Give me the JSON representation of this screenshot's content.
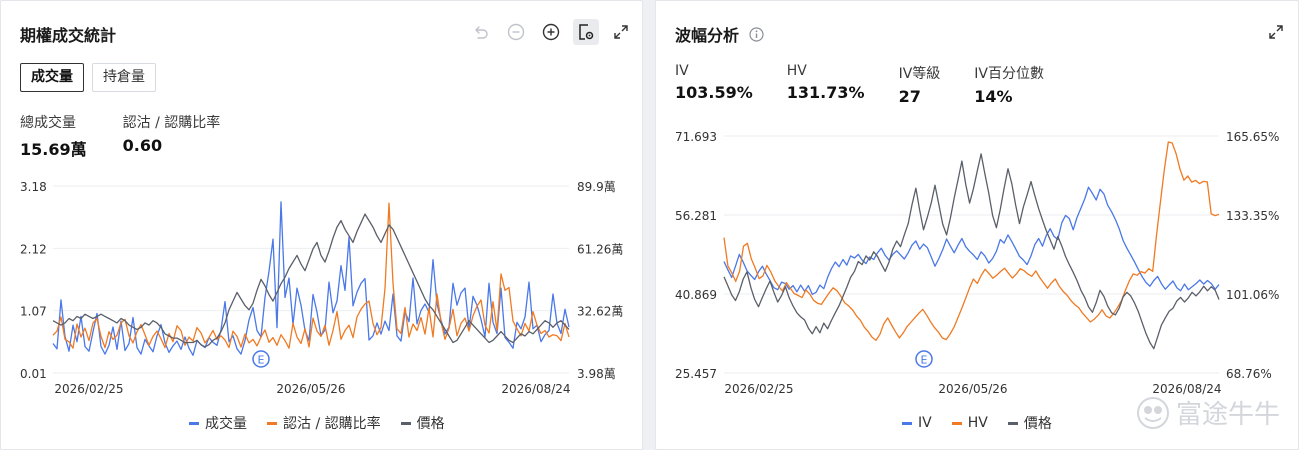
{
  "left": {
    "title": "期權成交統計",
    "tabs": [
      {
        "label": "成交量",
        "active": true
      },
      {
        "label": "持倉量",
        "active": false
      }
    ],
    "stats": [
      {
        "label": "總成交量",
        "value": "15.69萬"
      },
      {
        "label": "認沽 / 認購比率",
        "value": "0.60"
      }
    ],
    "y_left_ticks": [
      "3.18",
      "2.12",
      "1.07",
      "0.01"
    ],
    "y_right_ticks": [
      "89.9萬",
      "61.26萬",
      "32.62萬",
      "3.98萬"
    ],
    "x_ticks": [
      "2026/02/25",
      "2026/05/26",
      "2026/08/24"
    ],
    "event_marker": "E",
    "legend": [
      "成交量",
      "認沽 / 認購比率",
      "價格"
    ]
  },
  "right": {
    "title": "波幅分析",
    "stats": [
      {
        "label": "IV",
        "value": "103.59%"
      },
      {
        "label": "HV",
        "value": "131.73%"
      },
      {
        "label": "IV等級",
        "value": "27"
      },
      {
        "label": "IV百分位數",
        "value": "14%"
      }
    ],
    "y_left_ticks": [
      "71.693",
      "56.281",
      "40.869",
      "25.457"
    ],
    "y_right_ticks": [
      "165.65%",
      "133.35%",
      "101.06%",
      "68.76%"
    ],
    "x_ticks": [
      "2026/02/25",
      "2026/05/26",
      "2026/08/24"
    ],
    "event_marker": "E",
    "legend": [
      "IV",
      "HV",
      "價格"
    ],
    "watermark": "富途牛牛"
  },
  "colors": {
    "blue": "#4a78e8",
    "orange": "#f07a22",
    "gray": "#5a5f69",
    "grid": "#eceef1",
    "axis_text": "#333333"
  },
  "icons": [
    "undo-icon",
    "zoom-out-icon",
    "zoom-in-icon",
    "chart-settings-icon",
    "expand-icon",
    "info-icon"
  ],
  "chart_data": [
    {
      "type": "line",
      "title": "",
      "x_ticks": [
        "2026/02/25",
        "2026/05/26",
        "2026/08/24"
      ],
      "x_count": 130,
      "series": [
        {
          "name": "成交量",
          "axis": "left",
          "color": "#4a78e8",
          "ylim": [
            0.01,
            3.18
          ],
          "values": [
            0.51,
            0.42,
            1.25,
            0.63,
            0.38,
            0.82,
            0.54,
            0.97,
            0.46,
            0.38,
            0.71,
            1.02,
            0.46,
            0.33,
            0.48,
            0.79,
            0.41,
            0.89,
            0.39,
            0.51,
            0.95,
            0.44,
            0.33,
            0.58,
            0.47,
            0.37,
            0.64,
            0.83,
            0.52,
            0.36,
            0.47,
            0.55,
            0.41,
            0.62,
            0.43,
            0.31,
            0.56,
            0.49,
            0.44,
            0.61,
            0.53,
            0.48,
            0.74,
            1.22,
            0.54,
            0.64,
            0.42,
            0.33,
            0.56,
            0.91,
            1.12,
            0.73,
            0.62,
            1.29,
            1.73,
            2.28,
            0.78,
            2.91,
            1.29,
            1.62,
            0.83,
            1.45,
            1.16,
            0.73,
            0.56,
            1.34,
            1.04,
            0.64,
            0.74,
            1.55,
            1.03,
            1.23,
            1.83,
            1.41,
            2.31,
            1.15,
            1.38,
            1.53,
            1.61,
            0.57,
            0.64,
            0.86,
            0.67,
            0.89,
            0.73,
            1.35,
            0.64,
            0.55,
            1.05,
            0.88,
            1.62,
            0.84,
            1.07,
            1.18,
            1.04,
            1.93,
            1.18,
            0.91,
            0.67,
            0.79,
            1.53,
            1.16,
            1.37,
            1.45,
            0.75,
            1.31,
            1.16,
            0.92,
            0.62,
            1.53,
            0.87,
            0.68,
            1.45,
            0.61,
            0.53,
            0.43,
            0.87,
            0.76,
            0.96,
            1.55,
            0.76,
            0.82,
            0.54,
            0.66,
            0.73,
            1.35,
            0.85,
            0.68,
            1.09,
            0.79
          ]
        },
        {
          "name": "認沽 / 認購比率",
          "axis": "left",
          "color": "#f07a22",
          "ylim": [
            0.01,
            3.18
          ],
          "values": [
            0.65,
            0.72,
            0.96,
            0.58,
            0.54,
            0.43,
            0.84,
            0.62,
            0.77,
            0.56,
            0.86,
            0.93,
            0.63,
            0.44,
            0.71,
            0.58,
            0.65,
            0.86,
            0.92,
            0.64,
            0.52,
            0.71,
            0.83,
            0.66,
            0.48,
            0.63,
            0.72,
            0.59,
            0.44,
            0.68,
            0.54,
            0.81,
            0.73,
            0.48,
            0.62,
            0.55,
            0.78,
            0.69,
            0.52,
            0.61,
            0.73,
            0.58,
            0.64,
            0.57,
            0.44,
            0.72,
            0.63,
            0.45,
            0.67,
            0.52,
            0.58,
            0.47,
            0.62,
            0.74,
            0.53,
            0.61,
            0.48,
            0.66,
            0.56,
            0.43,
            0.85,
            0.62,
            0.51,
            0.76,
            0.45,
            0.94,
            0.72,
            0.63,
            0.82,
            0.48,
            0.73,
            1.05,
            0.58,
            0.73,
            0.82,
            0.61,
            0.96,
            1.09,
            1.18,
            1.23,
            0.85,
            0.66,
            0.78,
            1.44,
            2.89,
            1.53,
            0.76,
            0.68,
            1.12,
            0.62,
            0.84,
            0.73,
            0.95,
            0.67,
            1.11,
            0.62,
            1.35,
            0.88,
            0.58,
            0.77,
            1.09,
            0.64,
            0.85,
            0.94,
            0.72,
            0.98,
            1.14,
            1.25,
            0.82,
            0.69,
            1.22,
            0.73,
            1.69,
            1.41,
            1.46,
            0.89,
            0.76,
            0.64,
            0.85,
            0.72,
            1.05,
            0.82,
            0.68,
            0.73,
            0.62,
            0.66,
            0.64,
            0.56,
            0.85,
            0.62
          ]
        },
        {
          "name": "價格",
          "axis": "right",
          "color": "#5a5f69",
          "ylim": [
            3.98,
            89.9
          ],
          "values": [
            28,
            27,
            26,
            27,
            29,
            28,
            30,
            29,
            31,
            30,
            29,
            30,
            31,
            30,
            29,
            28,
            27,
            29,
            28,
            26,
            25,
            24,
            25,
            27,
            26,
            28,
            27,
            25,
            22,
            21,
            20,
            20,
            19,
            18,
            18,
            18,
            19,
            17,
            16,
            17,
            19,
            20,
            23,
            27,
            33,
            37,
            41,
            38,
            35,
            33,
            36,
            42,
            47,
            44,
            40,
            37,
            41,
            45,
            48,
            52,
            55,
            58,
            54,
            51,
            56,
            61,
            64,
            58,
            55,
            60,
            66,
            71,
            74,
            70,
            67,
            64,
            69,
            73,
            77,
            74,
            71,
            67,
            64,
            68,
            72,
            70,
            66,
            62,
            58,
            54,
            50,
            46,
            42,
            38,
            35,
            33,
            30,
            27,
            24,
            21,
            18,
            19,
            22,
            25,
            28,
            26,
            24,
            22,
            20,
            18,
            19,
            21,
            23,
            21,
            19,
            18,
            20,
            22,
            21,
            23,
            22,
            24,
            26,
            28,
            27,
            25,
            27,
            28,
            26,
            24
          ]
        }
      ]
    },
    {
      "type": "line",
      "title": "",
      "x_ticks": [
        "2026/02/25",
        "2026/05/26",
        "2026/08/24"
      ],
      "x_count": 130,
      "series": [
        {
          "name": "IV",
          "axis": "left",
          "color": "#4a78e8",
          "ylim": [
            25.457,
            71.693
          ],
          "values": [
            47.2,
            45.6,
            44.1,
            46.3,
            48.6,
            47.1,
            45.4,
            44.5,
            43.7,
            45.2,
            46.3,
            44.8,
            43.5,
            42.1,
            41.7,
            43.2,
            42.9,
            41.8,
            42.5,
            41.3,
            42.6,
            41.4,
            42.5,
            40.8,
            41.2,
            42.6,
            41.9,
            44.1,
            45.8,
            47.1,
            46.2,
            47.6,
            46.5,
            48.3,
            47.9,
            48.6,
            47.5,
            46.8,
            48.1,
            47.6,
            48.9,
            49.8,
            48.4,
            47.5,
            48.6,
            49.3,
            48.5,
            47.7,
            48.9,
            50.4,
            51.2,
            49.6,
            50.6,
            49.9,
            48.1,
            46.3,
            47.8,
            49.5,
            51.6,
            50.2,
            48.9,
            50.4,
            51.7,
            50.1,
            49.2,
            48.5,
            47.6,
            49.1,
            48.3,
            46.9,
            47.8,
            49.2,
            51.5,
            50.8,
            52.4,
            51.1,
            49.7,
            48.2,
            47.5,
            46.6,
            48.3,
            50.5,
            51.7,
            50.2,
            52.3,
            53.6,
            52.1,
            51.5,
            54.7,
            56.2,
            55.6,
            53.4,
            55.8,
            57.6,
            59.4,
            61.7,
            60.5,
            59.2,
            61.3,
            60.4,
            58.2,
            56.9,
            55.4,
            53.6,
            51.3,
            49.8,
            48.5,
            47.1,
            45.6,
            44.2,
            43.1,
            42.4,
            43.5,
            44.3,
            42.9,
            41.8,
            42.6,
            43.4,
            42.1,
            41.5,
            42.8,
            41.7,
            42.3,
            42.9,
            43.6,
            42.8,
            43.5,
            42.9,
            41.8,
            42.7
          ]
        },
        {
          "name": "HV",
          "axis": "right",
          "color": "#f07a22",
          "ylim": [
            68.76,
            165.65
          ],
          "values": [
            124.1,
            112.5,
            109.7,
            106.2,
            110.4,
            120.6,
            121.8,
            115.4,
            111.7,
            107.3,
            108.5,
            112.8,
            110.1,
            106.5,
            104.2,
            102.3,
            105.7,
            103.4,
            101.2,
            100.5,
            99.6,
            102.7,
            101.1,
            98.5,
            97.3,
            96.8,
            99.2,
            101.5,
            103.6,
            102.4,
            100.1,
            97.4,
            96.2,
            94.5,
            92.1,
            90.3,
            87.5,
            85.7,
            83.4,
            82.1,
            84.6,
            88.9,
            91.3,
            88.4,
            85.6,
            83.1,
            85.2,
            87.8,
            89.6,
            91.4,
            93.2,
            94.8,
            92.4,
            89.7,
            87.3,
            85.5,
            83.1,
            82.4,
            84.7,
            87.5,
            91.3,
            95.2,
            99.4,
            103.6,
            107.2,
            105.4,
            108.6,
            111.2,
            109.4,
            107.5,
            108.8,
            110.3,
            111.6,
            109.5,
            107.6,
            109.2,
            111.4,
            110.6,
            109.2,
            108.3,
            110.5,
            107.8,
            105.6,
            103.4,
            105.6,
            107.2,
            104.3,
            102.1,
            100.6,
            98.4,
            96.7,
            95.5,
            93.2,
            91.4,
            89.6,
            90.8,
            92.4,
            94.6,
            92.1,
            91.3,
            93.2,
            95.6,
            98.4,
            102.7,
            106.5,
            109.3,
            108.7,
            110.2,
            109.6,
            111.4,
            110.3,
            125.4,
            138.9,
            152.1,
            163.2,
            162.8,
            158.4,
            152.1,
            147.6,
            149.3,
            146.8,
            147.5,
            146.2,
            147.1,
            146.9,
            133.8,
            133.1,
            133.6
          ]
        },
        {
          "name": "價格",
          "axis": "left",
          "color": "#5a5f69",
          "ylim": [
            25.457,
            71.693
          ],
          "values": [
            44.2,
            42.5,
            40.7,
            39.6,
            41.3,
            43.8,
            45.2,
            42.1,
            39.8,
            38.4,
            40.2,
            41.9,
            43.4,
            41.2,
            39.3,
            40.6,
            42.3,
            40.1,
            38.5,
            37.2,
            36.4,
            35.8,
            34.2,
            33.1,
            34.5,
            33.3,
            35.2,
            34.1,
            35.7,
            37.2,
            38.6,
            40.4,
            42.2,
            44.1,
            45.3,
            47.2,
            46.6,
            48.3,
            47.5,
            49.1,
            48.2,
            46.7,
            45.3,
            47.1,
            49.6,
            51.2,
            50.1,
            52.4,
            54.6,
            58.3,
            61.5,
            57.2,
            53.4,
            55.9,
            58.6,
            62.1,
            58.3,
            54.5,
            52.4,
            55.7,
            59.6,
            63.2,
            66.8,
            62.3,
            58.6,
            61.4,
            64.9,
            68.2,
            64.3,
            60.5,
            56.2,
            53.8,
            57.4,
            61.5,
            65.3,
            62.4,
            58.3,
            54.6,
            57.8,
            60.2,
            62.8,
            60.1,
            57.5,
            55.3,
            53.2,
            51.4,
            49.6,
            52.1,
            50.3,
            48.2,
            46.6,
            45.1,
            43.5,
            41.6,
            40.2,
            38.4,
            37.3,
            39.2,
            41.6,
            40.4,
            38.5,
            37.2,
            36.8,
            38.1,
            40.3,
            41.2,
            40.5,
            39.1,
            37.4,
            35.2,
            33.1,
            31.4,
            30.2,
            32.5,
            34.8,
            36.2,
            37.5,
            38.1,
            39.5,
            40.2,
            39.3,
            40.1,
            41.2,
            40.5,
            41.3,
            42.4,
            41.5,
            42.3,
            41.6,
            39.8
          ]
        }
      ]
    }
  ]
}
